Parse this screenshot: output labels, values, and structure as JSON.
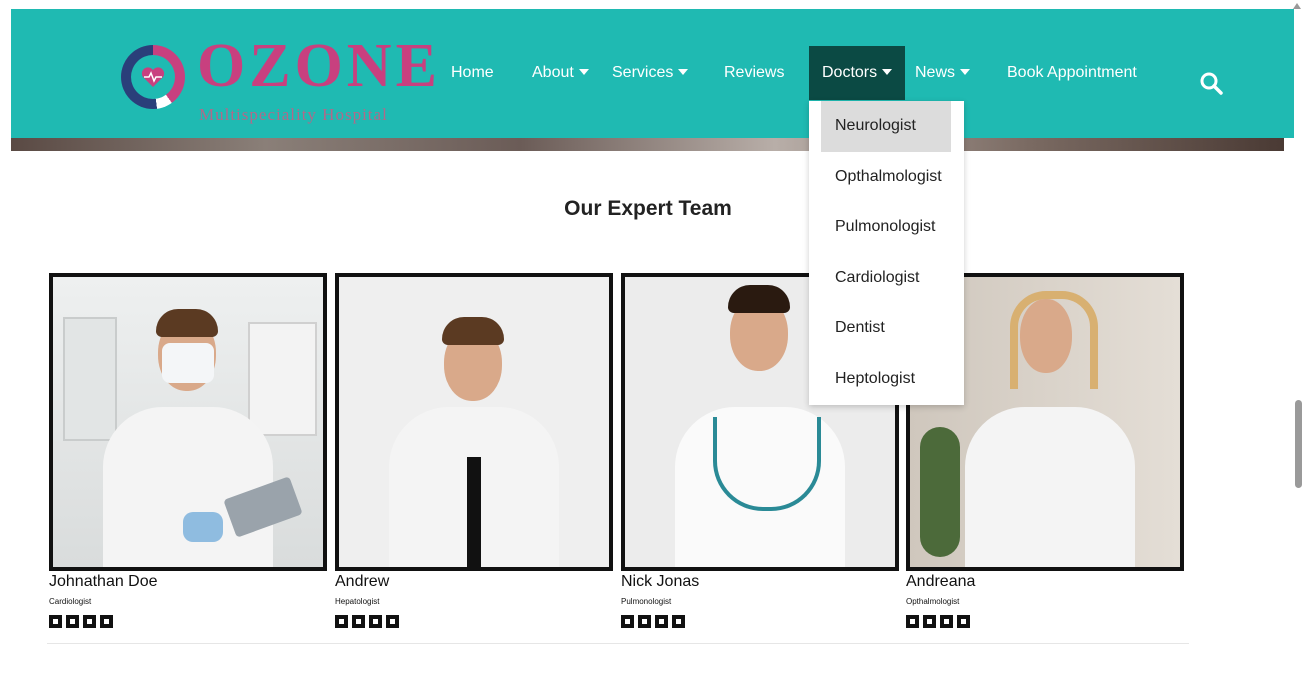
{
  "brand": {
    "name": "OZONE",
    "tagline": "Multispeciality Hospital",
    "colors": {
      "nav_bg": "#1fbab2",
      "active_bg": "#0b4a44",
      "logo": "#c8407f"
    }
  },
  "nav": {
    "items": [
      {
        "label": "Home",
        "has_dropdown": false
      },
      {
        "label": "About",
        "has_dropdown": true
      },
      {
        "label": "Services",
        "has_dropdown": true
      },
      {
        "label": "Reviews",
        "has_dropdown": false
      },
      {
        "label": "Doctors",
        "has_dropdown": true,
        "active": true
      },
      {
        "label": "News",
        "has_dropdown": true
      },
      {
        "label": "Book Appointment",
        "has_dropdown": false
      }
    ],
    "search_icon": "search-icon"
  },
  "dropdown": {
    "items": [
      "Neurologist",
      "Opthalmologist",
      "Pulmonologist",
      "Cardiologist",
      "Dentist",
      "Heptologist"
    ],
    "hovered": "Neurologist"
  },
  "team": {
    "title": "Our Expert Team",
    "doctors": [
      {
        "name": "Johnathan Doe",
        "role": "Cardiologist"
      },
      {
        "name": "Andrew",
        "role": "Hepatologist"
      },
      {
        "name": "Nick Jonas",
        "role": "Pulmonologist"
      },
      {
        "name": "Andreana",
        "role": "Opthalmologist"
      }
    ],
    "social_icons": [
      "facebook-icon",
      "twitter-icon",
      "linkedin-icon",
      "instagram-icon"
    ]
  }
}
